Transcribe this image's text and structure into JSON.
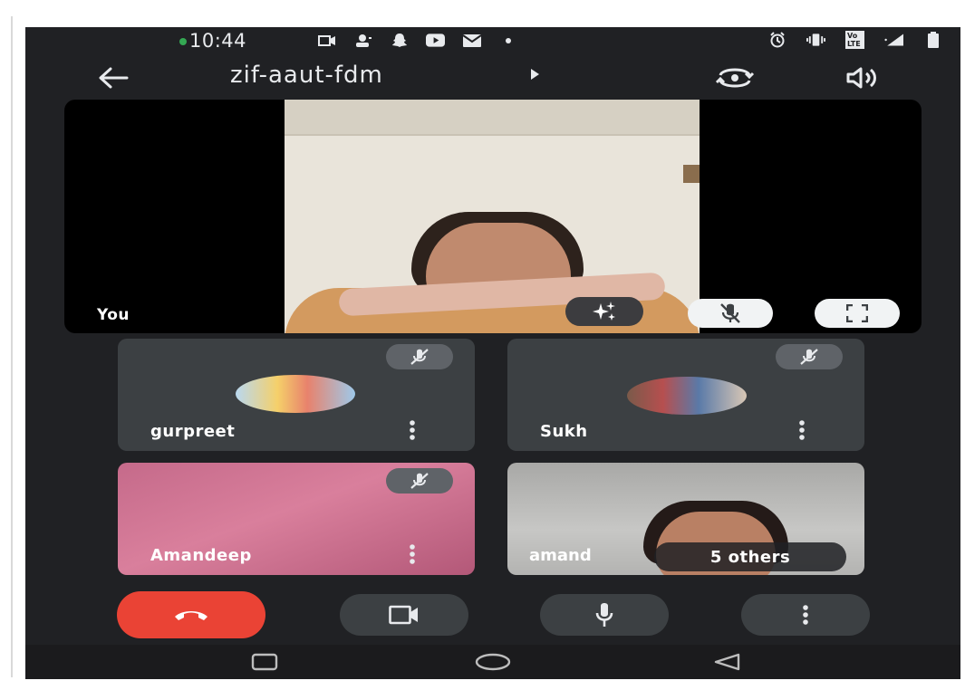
{
  "status_bar": {
    "time": "10:44",
    "dot_color": "#34a853",
    "left_icons": [
      "video-cam-icon",
      "contacts-icon",
      "snapchat-icon",
      "youtube-icon",
      "mail-icon",
      "more-dot-icon"
    ],
    "right_icons": [
      "alarm-icon",
      "vibrate-icon",
      "volte-icon",
      "signal-icon",
      "battery-icon"
    ],
    "volte_label": "Vo LTE"
  },
  "header": {
    "meeting_code": "zif-aaut-fdm"
  },
  "self_tile": {
    "name": "You"
  },
  "participants": [
    {
      "name": "gurpreet",
      "avatar": true,
      "muted": true
    },
    {
      "name": "Sukh",
      "avatar": true,
      "muted": true
    },
    {
      "name": "Amandeep",
      "avatar": false,
      "muted": true
    },
    {
      "name": "amand",
      "avatar": false,
      "muted": false
    }
  ],
  "others_chip": "5 others",
  "colors": {
    "background": "#202124",
    "tile": "#3c4043",
    "end_call": "#ea4335",
    "text": "#e8eaed"
  }
}
